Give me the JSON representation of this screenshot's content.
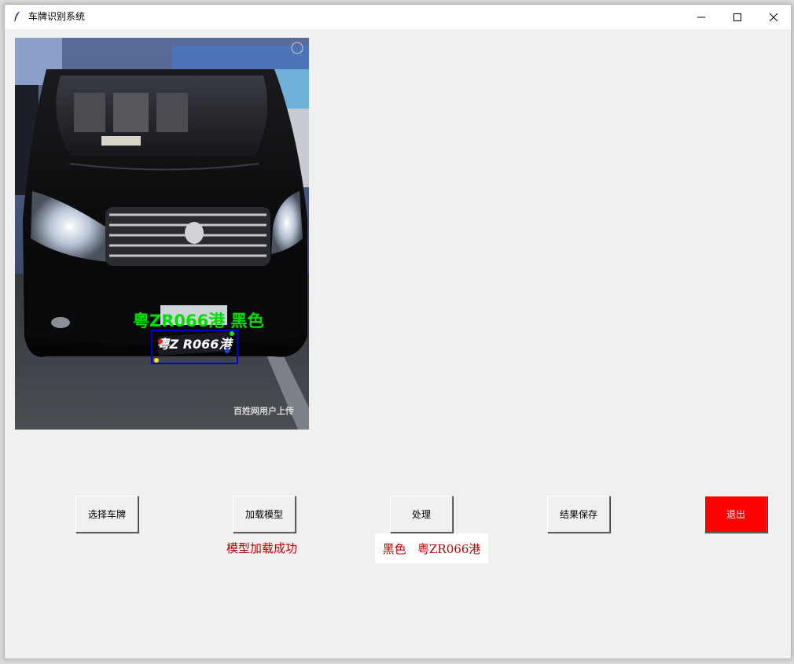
{
  "window": {
    "title": "车牌识别系统"
  },
  "photo": {
    "overlay_text": "粤ZR066港 黑色",
    "plate_text": "粤Z R066港",
    "watermark": "百姓网用户上传",
    "overlay_color": "#00e000",
    "box_color": "#0000cc"
  },
  "buttons": {
    "select_plate": "选择车牌",
    "load_model": "加载模型",
    "process": "处理",
    "save_result": "结果保存",
    "exit": "退出"
  },
  "status": {
    "model_loaded": "模型加载成功"
  },
  "result": {
    "color": "黑色",
    "plate": "粤ZR066港"
  },
  "colors": {
    "exit_button_bg": "#ff0000",
    "status_text": "#c00000"
  }
}
